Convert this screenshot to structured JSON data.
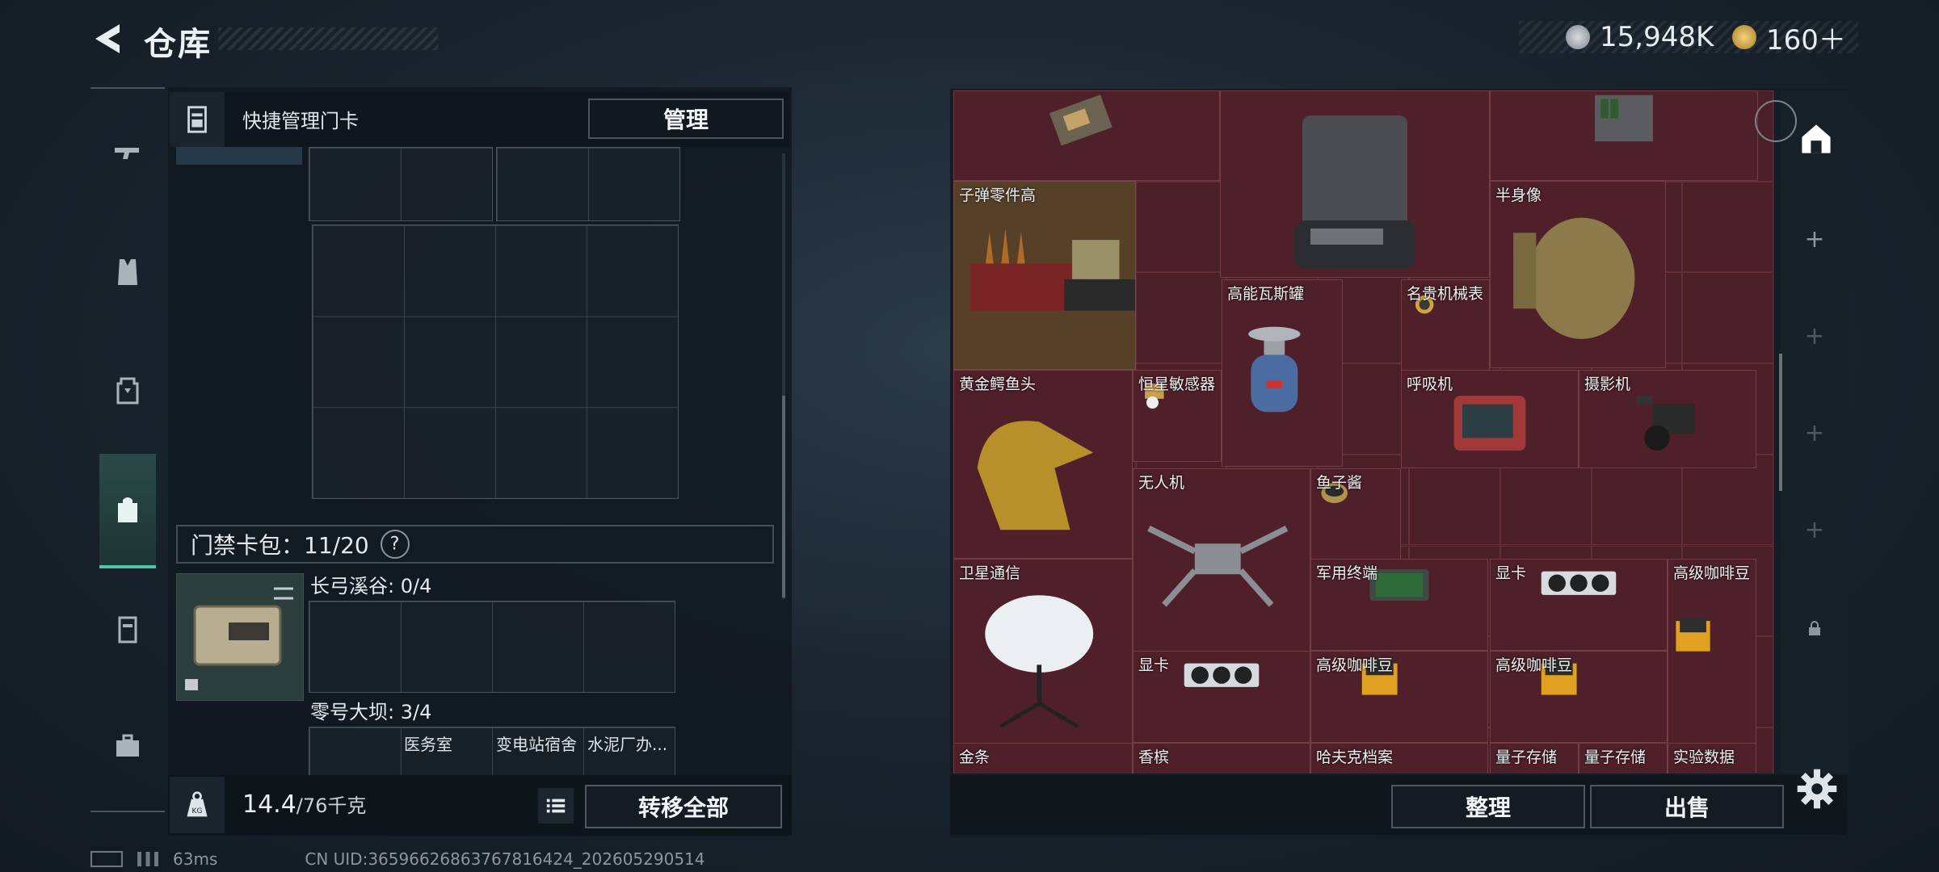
{
  "header": {
    "title": "仓库"
  },
  "currency": [
    {
      "icon": "silver-coin-icon",
      "value": "15,948K"
    },
    {
      "icon": "gold-coin-icon",
      "value": "160＋"
    }
  ],
  "left_panel": {
    "header_label": "快捷管理门卡",
    "manage_label": "管理",
    "card_pack_label": "门禁卡包：11/20",
    "help_mark": "?",
    "groups": [
      {
        "label": "长弓溪谷: 0/4"
      },
      {
        "label": "零号大坝: 3/4"
      }
    ],
    "card_slots": [
      "医务室",
      "变电站宿舍",
      "水泥厂办..."
    ],
    "weight_value": "14.4",
    "weight_unit": "/76千克",
    "kg_badge": "KG",
    "transfer_all_label": "转移全部"
  },
  "stash_items": [
    {
      "label": "子弹零件高"
    },
    {
      "label": "半身像"
    },
    {
      "label": "高能瓦斯罐"
    },
    {
      "label": "名贵机械表"
    },
    {
      "label": "黄金鳄鱼头"
    },
    {
      "label": "恒星敏感器"
    },
    {
      "label": "呼吸机"
    },
    {
      "label": "摄影机"
    },
    {
      "label": "无人机"
    },
    {
      "label": "鱼子酱"
    },
    {
      "label": "卫星通信"
    },
    {
      "label": "军用终端"
    },
    {
      "label": "显卡"
    },
    {
      "label": "高级咖啡豆"
    },
    {
      "label": "显卡"
    },
    {
      "label": "高级咖啡豆"
    },
    {
      "label": "高级咖啡豆"
    },
    {
      "label": "金条"
    },
    {
      "label": "香槟"
    },
    {
      "label": "哈夫克档案"
    },
    {
      "label": "量子存储"
    },
    {
      "label": "量子存储"
    },
    {
      "label": "实验数据"
    }
  ],
  "right_panel": {
    "sort_label": "整理",
    "sell_label": "出售"
  },
  "status": {
    "ping": "63ms",
    "uid": "CN UID:3659662686376781642​4_202605290514"
  }
}
